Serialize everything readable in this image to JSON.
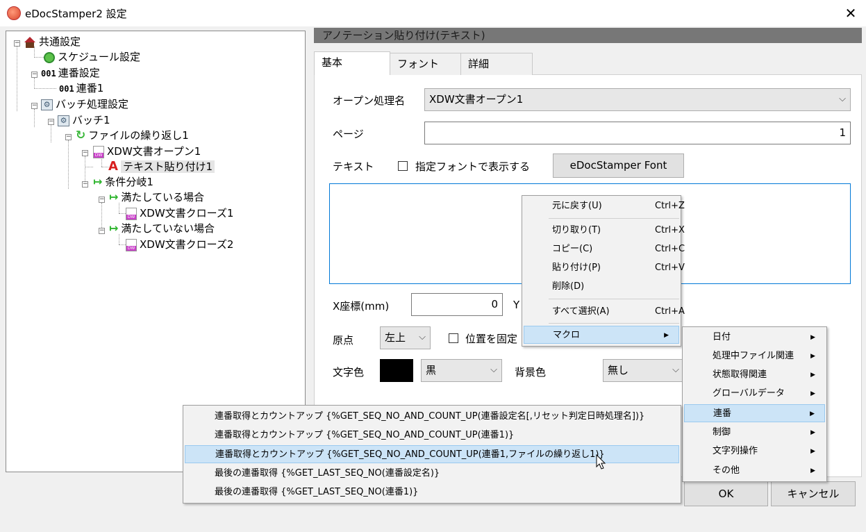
{
  "window": {
    "title": "eDocStamper2 設定",
    "close": "✕"
  },
  "tree": {
    "common": "共通設定",
    "schedule": "スケジュール設定",
    "seq_settings": "連番設定",
    "seq_icon": "001",
    "seq1": "連番1",
    "batch_settings": "バッチ処理設定",
    "batch1": "バッチ1",
    "file_loop": "ファイルの繰り返し1",
    "xdw_open": "XDW文書オープン1",
    "text_paste": "テキスト貼り付け1",
    "cond_branch": "条件分岐1",
    "satisfied": "満たしている場合",
    "xdw_close1": "XDW文書クローズ1",
    "not_satisfied": "満たしていない場合",
    "xdw_close2": "XDW文書クローズ2"
  },
  "panel": {
    "header": "アノテーション貼り付け(テキスト)",
    "tabs": [
      "基本",
      "フォント",
      "詳細"
    ],
    "open_label": "オープン処理名",
    "open_value": "XDW文書オープン1",
    "page_label": "ページ",
    "page_value": "1",
    "text_label": "テキスト",
    "font_check_label": "指定フォントで表示する",
    "font_button": "eDocStamper Font",
    "x_label": "X座標(mm)",
    "x_value": "0",
    "y_label": "Y",
    "origin_label": "原点",
    "origin_value": "左上",
    "fix_check_label": "位置を固定",
    "color_label": "文字色",
    "color_value": "黒",
    "bg_label": "背景色",
    "bg_value": "無し",
    "ok": "OK",
    "cancel": "キャンセル"
  },
  "context_menu": {
    "undo": "元に戻す(U)",
    "undo_key": "Ctrl+Z",
    "cut": "切り取り(T)",
    "cut_key": "Ctrl+X",
    "copy": "コピー(C)",
    "copy_key": "Ctrl+C",
    "paste": "貼り付け(P)",
    "paste_key": "Ctrl+V",
    "delete": "削除(D)",
    "select_all": "すべて選択(A)",
    "select_all_key": "Ctrl+A",
    "macro": "マクロ"
  },
  "macro_menu": [
    "日付",
    "処理中ファイル関連",
    "状態取得関連",
    "グローバルデータ",
    "連番",
    "制御",
    "文字列操作",
    "その他"
  ],
  "seq_menu": [
    "連番取得とカウントアップ {%GET_SEQ_NO_AND_COUNT_UP(連番設定名[,リセット判定日時処理名])}",
    "連番取得とカウントアップ {%GET_SEQ_NO_AND_COUNT_UP(連番1)}",
    "連番取得とカウントアップ {%GET_SEQ_NO_AND_COUNT_UP(連番1,ファイルの繰り返し1)}",
    "最後の連番取得 {%GET_LAST_SEQ_NO(連番設定名)}",
    "最後の連番取得 {%GET_LAST_SEQ_NO(連番1)}"
  ]
}
